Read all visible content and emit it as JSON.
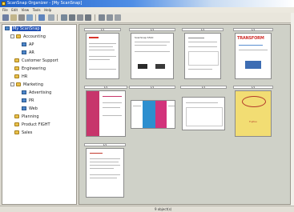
{
  "window": {
    "title": "ScanSnap Organizer - [My ScanSnap]"
  },
  "menu": [
    "File",
    "Edit",
    "View",
    "Tools",
    "Help"
  ],
  "toolbar": {
    "buttons": [
      "scan-icon",
      "open-icon",
      "print-icon",
      "email-icon",
      "view-icon",
      "search-icon",
      "zoom-icon",
      "rotate-icon",
      "delete-icon",
      "folder-icon",
      "help-icon"
    ]
  },
  "sidebar": {
    "items": [
      {
        "label": "My ScanSnap",
        "level": 0,
        "selected": true
      },
      {
        "label": "Accounting",
        "level": 1
      },
      {
        "label": "AP",
        "level": 2
      },
      {
        "label": "AR",
        "level": 2
      },
      {
        "label": "Customer Support",
        "level": 1
      },
      {
        "label": "Engineering",
        "level": 1
      },
      {
        "label": "HR",
        "level": 1
      },
      {
        "label": "Marketing",
        "level": 1
      },
      {
        "label": "Advertising",
        "level": 2
      },
      {
        "label": "PR",
        "level": 2
      },
      {
        "label": "Web",
        "level": 2
      },
      {
        "label": "Planning",
        "level": 1
      },
      {
        "label": "Product FIGHT",
        "level": 1
      },
      {
        "label": "Sales",
        "level": 1
      }
    ]
  },
  "documents": {
    "items": [
      {
        "page": "1/1",
        "headline": "",
        "accent": "#d9352b"
      },
      {
        "page": "1/1",
        "headline": "ScanSnap S510",
        "accent": "#2a2a2a"
      },
      {
        "page": "1/1",
        "headline": "",
        "accent": "#9aa3ad"
      },
      {
        "page": "1/1",
        "headline": "TRANSFORM",
        "accent": "#d0312d"
      },
      {
        "page": "1/1",
        "headline": "",
        "accent": "#c7356b"
      },
      {
        "page": "1/1",
        "headline": "",
        "accent": "#3b6fb5"
      },
      {
        "page": "1/1",
        "headline": "",
        "accent": "#7a8696"
      },
      {
        "page": "1/1",
        "headline": "Fujitsu",
        "accent": "#f2dd73"
      },
      {
        "page": "1/1",
        "headline": "",
        "accent": "#c23b2f"
      }
    ]
  },
  "status": {
    "text": "9 object(s)"
  }
}
